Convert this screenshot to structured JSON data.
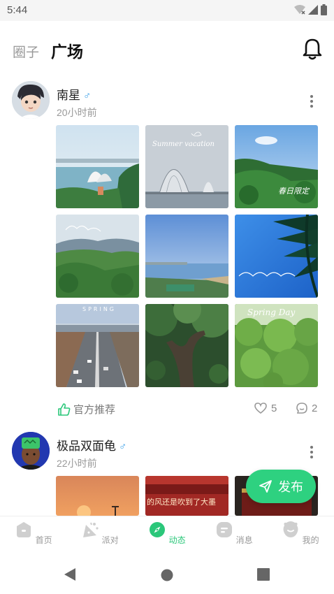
{
  "status_bar": {
    "time": "5:44"
  },
  "header": {
    "tab_circle": "圈子",
    "tab_square": "广场"
  },
  "posts": [
    {
      "username": "南星",
      "gender": "♂",
      "time": "20小时前",
      "recommend": "官方推荐",
      "likes": "5",
      "comments": "2"
    },
    {
      "username": "极品双面龟",
      "gender": "♂",
      "time": "22小时前"
    }
  ],
  "fab": {
    "label": "发布"
  },
  "tabbar": {
    "items": [
      {
        "label": "首页"
      },
      {
        "label": "派对"
      },
      {
        "label": "动态"
      },
      {
        "label": "消息"
      },
      {
        "label": "我的"
      }
    ]
  },
  "image_captions": {
    "img2": "Summer vacation",
    "img9": "Spring Day",
    "img7": "SPRING",
    "img3": "春日限定"
  },
  "post2_image_text": "的风还是吹到了大墨",
  "colors": {
    "accent": "#2ed180",
    "active_tab": "#2bc77a",
    "gender": "#3aa0e8"
  }
}
